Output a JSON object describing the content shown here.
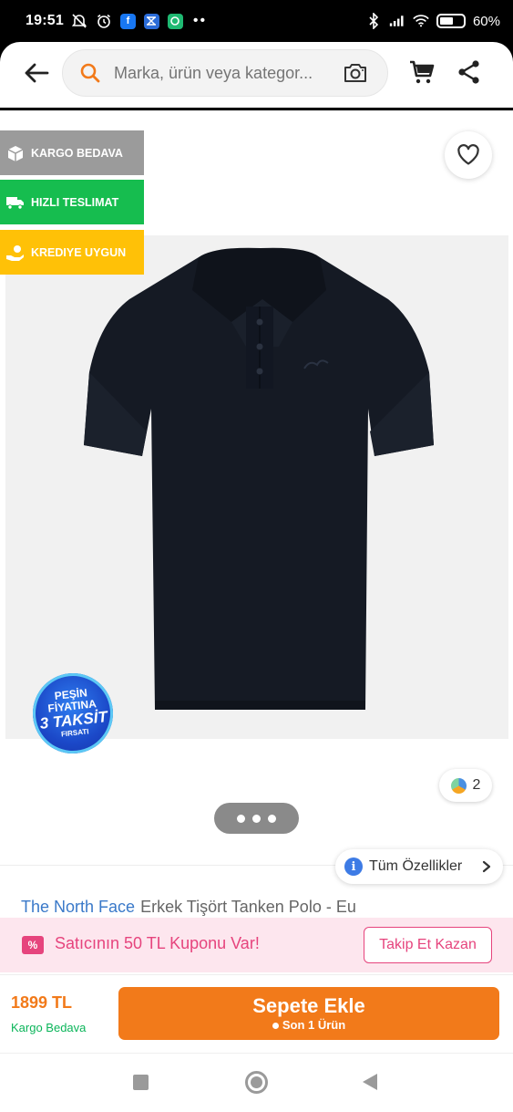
{
  "status_bar": {
    "time": "19:51",
    "battery": "60%"
  },
  "header": {
    "back_icon": "arrow-left-icon",
    "search": {
      "placeholder": "Marka, ürün veya kategor...",
      "search_icon": "search-icon",
      "camera_icon": "camera-icon"
    },
    "cart_icon": "cart-icon",
    "share_icon": "share-icon"
  },
  "badges": [
    {
      "label": "Kargo Bedava",
      "icon": "box-icon",
      "color": "#9b9b9b"
    },
    {
      "label": "Hızlı Teslimat",
      "icon": "truck-icon",
      "color": "#16bd4f"
    },
    {
      "label": "Krediye Uygun",
      "icon": "hand-coin-icon",
      "color": "#ffc107"
    }
  ],
  "favorite_icon": "heart-icon",
  "taksit_badge": {
    "line1": "PEŞİN",
    "line2": "FİYATINA",
    "line3": "3 TAKSİT",
    "line4": "FIRSATI"
  },
  "color_variants": {
    "count": "2"
  },
  "image_pager": {
    "dots": 3
  },
  "all_specs": {
    "label": "Tüm Özellikler"
  },
  "product": {
    "brand": "The North Face",
    "name": "Erkek Tişört Tanken Polo - Eu"
  },
  "coupon": {
    "icon_text": "%",
    "text": "Satıcının 50 TL Kuponu Var!",
    "button": "Takip Et Kazan"
  },
  "purchase": {
    "price": "1899 TL",
    "shipping": "Kargo Bedava",
    "add_to_cart": "Sepete Ekle",
    "stock_note": "Son 1 Ürün"
  },
  "colors": {
    "brand_orange": "#f27a1a",
    "coupon_pink": "#e6447d",
    "shipping_green": "#0bb55a",
    "brand_blue": "#3a79c9"
  }
}
